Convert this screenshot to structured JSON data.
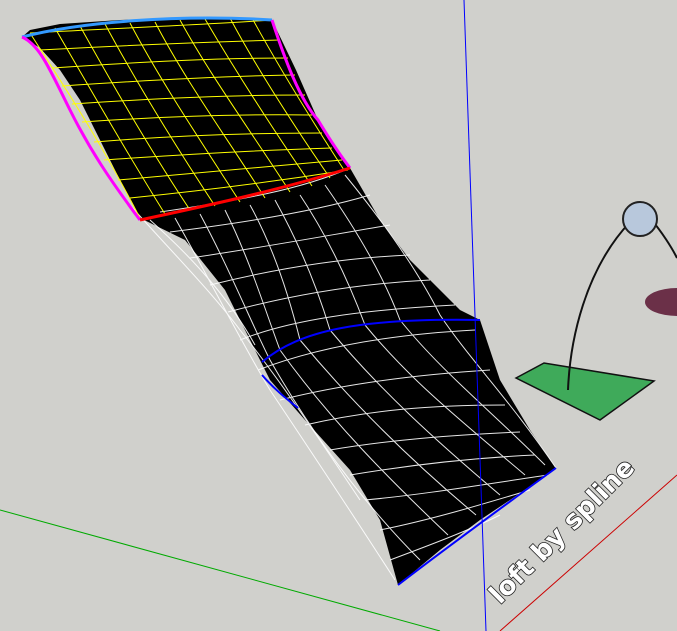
{
  "scene": {
    "label_text": "loft by spline",
    "colors": {
      "background": "#d0d0cc",
      "surface": "#000000",
      "mesh_lower": "#ffffff",
      "mesh_upper": "#ffff00",
      "section_top": "#3399ff",
      "section_red": "#ff0000",
      "section_blue": "#0000ff",
      "rail_magenta": "#ff00ff",
      "axis_blue": "#0000ff",
      "axis_green": "#00aa00",
      "axis_red": "#cc0000",
      "ground_square": "#3faa5a",
      "figure_head": "#b8c8dc",
      "ellipse": "#6b3048"
    },
    "icons": [
      "person-figure-icon"
    ]
  }
}
